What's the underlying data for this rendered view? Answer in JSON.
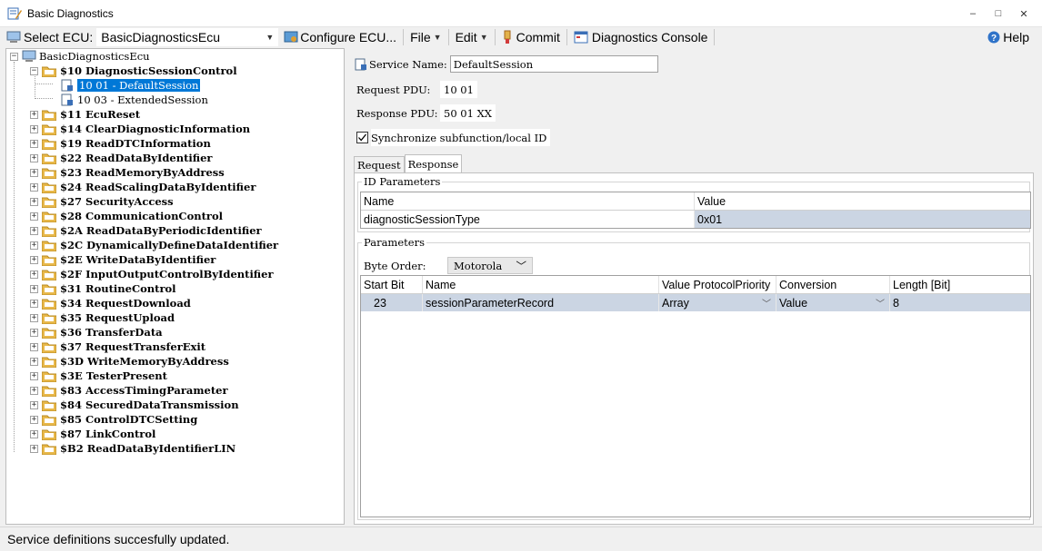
{
  "window": {
    "title": "Basic Diagnostics",
    "minimize": "–",
    "maximize": "□",
    "close": "✕"
  },
  "toolbar": {
    "select_ecu_label": "Select ECU:",
    "ecu_value": "BasicDiagnosticsEcu",
    "configure_ecu": "Configure ECU...",
    "file": "File",
    "edit": "Edit",
    "commit": "Commit",
    "diagnostics_console": "Diagnostics Console",
    "help": "Help"
  },
  "tree": {
    "root": "BasicDiagnosticsEcu",
    "expanded_service": "$10 DiagnosticSessionControl",
    "children": [
      "10 01 - DefaultSession",
      "10 03 - ExtendedSession"
    ],
    "services": [
      "$11 EcuReset",
      "$14 ClearDiagnosticInformation",
      "$19 ReadDTCInformation",
      "$22 ReadDataByIdentifier",
      "$23 ReadMemoryByAddress",
      "$24 ReadScalingDataByIdentifier",
      "$27 SecurityAccess",
      "$28 CommunicationControl",
      "$2A ReadDataByPeriodicIdentifier",
      "$2C DynamicallyDefineDataIdentifier",
      "$2E WriteDataByIdentifier",
      "$2F InputOutputControlByIdentifier",
      "$31 RoutineControl",
      "$34 RequestDownload",
      "$35 RequestUpload",
      "$36 TransferData",
      "$37 RequestTransferExit",
      "$3D WriteMemoryByAddress",
      "$3E TesterPresent",
      "$83 AccessTimingParameter",
      "$84 SecuredDataTransmission",
      "$85 ControlDTCSetting",
      "$87 LinkControl",
      "$B2 ReadDataByIdentifierLIN"
    ]
  },
  "details": {
    "service_name_label": "Service Name:",
    "service_name_value": "DefaultSession",
    "request_pdu_label": "Request PDU:",
    "request_pdu_value": "10 01",
    "response_pdu_label": "Response PDU:",
    "response_pdu_value": "50 01 XX",
    "sync_label": "Synchronize subfunction/local ID",
    "sync_checked": true
  },
  "tabs": [
    "Request",
    "Response"
  ],
  "id_parameters": {
    "group_label": "ID Parameters",
    "columns": [
      "Name",
      "Value"
    ],
    "rows": [
      [
        "diagnosticSessionType",
        "0x01"
      ]
    ]
  },
  "parameters": {
    "group_label": "Parameters",
    "byte_order_label": "Byte Order:",
    "byte_order_value": "Motorola",
    "columns": [
      "Start Bit",
      "Name",
      "Value ProtocolPriority",
      "Conversion",
      "Length [Bit]"
    ],
    "rows": [
      [
        "23",
        "sessionParameterRecord",
        "Array",
        "Value",
        "8"
      ]
    ]
  },
  "status": {
    "message": "Service definitions succesfully updated."
  },
  "colors": {
    "selection": "#0078d7",
    "row_highlight": "#cbd5e3",
    "folder": "#e8b84a"
  }
}
